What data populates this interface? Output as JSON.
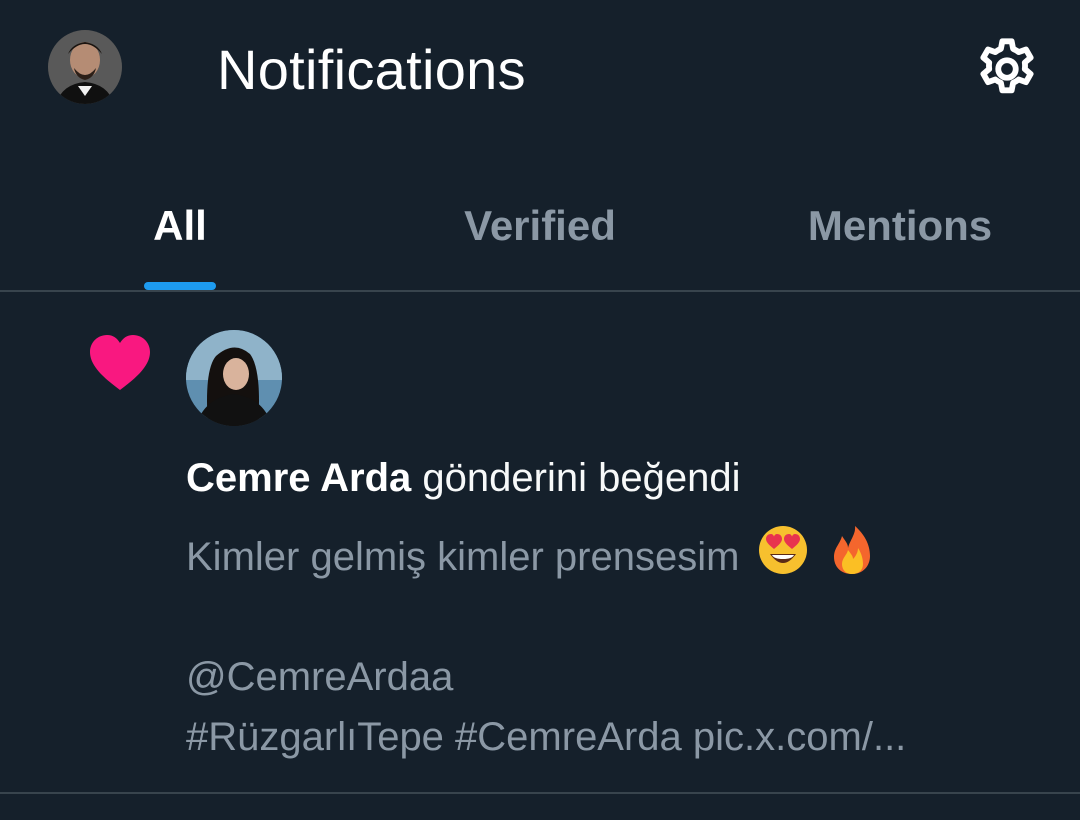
{
  "header": {
    "title": "Notifications",
    "profile_avatar_icon": "user-avatar",
    "settings_icon": "gear-icon"
  },
  "tabs": [
    {
      "label": "All",
      "active": true
    },
    {
      "label": "Verified",
      "active": false
    },
    {
      "label": "Mentions",
      "active": false
    }
  ],
  "colors": {
    "background": "#15202b",
    "accent": "#1d9bf0",
    "like": "#f91880",
    "muted_text": "#8b98a5",
    "divider": "#38444d"
  },
  "notifications": [
    {
      "type_icon": "heart-icon",
      "user_name": "Cemre Arda",
      "action": "gönderini beğendi",
      "body": {
        "line1": "Kimler gelmiş kimler prensesim",
        "line1_emojis": [
          "smiling-face-with-heart-eyes-emoji",
          "fire-emoji"
        ],
        "line2": "@CemreArdaa",
        "line3": "#RüzgarlıTepe #CemreArda pic.x.com/..."
      }
    }
  ]
}
